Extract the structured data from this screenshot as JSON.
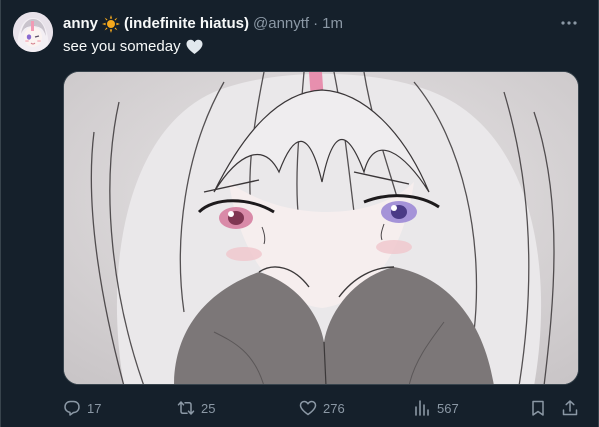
{
  "tweet": {
    "author": {
      "display_name": "anny",
      "display_name_suffix": "(indefinite hiatus)",
      "handle": "@annytf",
      "separator": "·",
      "time": "1m"
    },
    "text": "see you someday",
    "actions": {
      "replies": "17",
      "retweets": "25",
      "likes": "276",
      "views": "567"
    }
  },
  "colors": {
    "background": "#15202b",
    "text_primary": "#f7f9f9",
    "text_secondary": "#8b98a5",
    "border": "#38444d",
    "sun_emoji": "#f4a81d",
    "heart_emoji": "#e1e8ed"
  },
  "icons": {
    "more": "more-dots-icon",
    "reply": "reply-bubble-icon",
    "retweet": "retweet-arrows-icon",
    "like": "heart-outline-icon",
    "views": "bar-chart-icon",
    "bookmark": "bookmark-icon",
    "share": "share-upload-icon"
  }
}
